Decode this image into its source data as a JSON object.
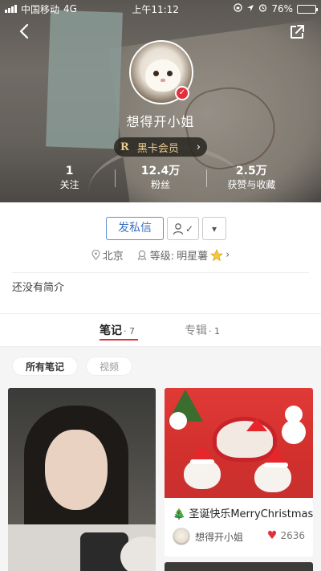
{
  "status_bar": {
    "carrier": "中国移动",
    "network": "4G",
    "time": "上午11:12",
    "battery_pct": "76%",
    "battery_level": 0.76
  },
  "nav": {
    "back_icon": "back-arrow-icon",
    "share_icon": "share-icon"
  },
  "profile": {
    "username": "想得开小姐",
    "vip_icon_text": "R",
    "vip_label": "黑卡会员",
    "vip_chevron": "›",
    "verified_mark": "✓",
    "stats": [
      {
        "num": "1",
        "label": "关注"
      },
      {
        "num": "12.4万",
        "label": "粉丝"
      },
      {
        "num": "2.5万",
        "label": "获赞与收藏"
      }
    ],
    "message_button": "发私信",
    "follow_check": "✓",
    "more_caret": "▾",
    "location": "北京",
    "level_prefix": "等级:",
    "level": "明星薯",
    "level_chevron": "›",
    "bio": "还没有简介"
  },
  "tabs": [
    {
      "label": "笔记",
      "count": "· 7",
      "active": true
    },
    {
      "label": "专辑",
      "count": "· 1",
      "active": false
    }
  ],
  "filters": [
    {
      "label": "所有笔记",
      "active": true
    },
    {
      "label": "视频",
      "active": false
    }
  ],
  "notes": [
    {
      "title_emoji": "🎄",
      "title": "圣诞快乐MerryChristmas",
      "author": "想得开小姐",
      "likes": "2636"
    }
  ],
  "colors": {
    "accent_red": "#e0303a",
    "message_blue": "#3d72c4",
    "vip_gold": "#e8cc8e"
  }
}
